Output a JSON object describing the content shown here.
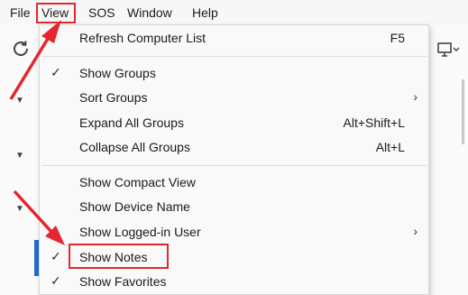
{
  "menubar": {
    "items": [
      {
        "label": "File"
      },
      {
        "label": "View"
      },
      {
        "label": "SOS"
      },
      {
        "label": "Window"
      },
      {
        "label": "Help"
      }
    ]
  },
  "view_menu": {
    "items": [
      {
        "label": "Refresh Computer List",
        "shortcut": "F5",
        "checked": false,
        "submenu": false
      },
      {
        "label": "Show Groups",
        "shortcut": "",
        "checked": true,
        "submenu": false
      },
      {
        "label": "Sort Groups",
        "shortcut": "",
        "checked": false,
        "submenu": true
      },
      {
        "label": "Expand All Groups",
        "shortcut": "Alt+Shift+L",
        "checked": false,
        "submenu": false
      },
      {
        "label": "Collapse All Groups",
        "shortcut": "Alt+L",
        "checked": false,
        "submenu": false
      },
      {
        "label": "Show Compact View",
        "shortcut": "",
        "checked": false,
        "submenu": false
      },
      {
        "label": "Show Device Name",
        "shortcut": "",
        "checked": false,
        "submenu": false
      },
      {
        "label": "Show Logged-in User",
        "shortcut": "",
        "checked": false,
        "submenu": true
      },
      {
        "label": "Show Notes",
        "shortcut": "",
        "checked": true,
        "submenu": false
      },
      {
        "label": "Show Favorites",
        "shortcut": "",
        "checked": true,
        "submenu": false
      }
    ],
    "check_glyph": "✓",
    "submenu_glyph": "›"
  },
  "annotations": {
    "highlight_color": "#e4262e"
  },
  "icons": {
    "refresh": "refresh-icon",
    "expand": "triangle-down-icon",
    "device": "monitor-icon"
  }
}
